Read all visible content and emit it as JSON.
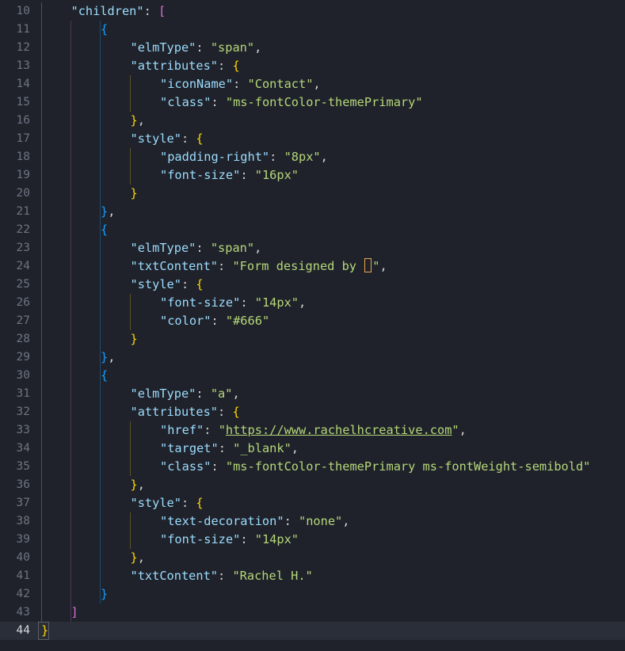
{
  "editor": {
    "active_line": 44,
    "lines": [
      {
        "num": "10",
        "tokens": [
          [
            "k",
            "\"children\""
          ],
          [
            "p",
            ": "
          ],
          [
            "b2",
            "["
          ]
        ]
      },
      {
        "num": "11",
        "tokens": [
          [
            "b3",
            "{"
          ]
        ]
      },
      {
        "num": "12",
        "tokens": [
          [
            "k",
            "\"elmType\""
          ],
          [
            "p",
            ": "
          ],
          [
            "s",
            "\"span\""
          ],
          [
            "p",
            ","
          ]
        ]
      },
      {
        "num": "13",
        "tokens": [
          [
            "k",
            "\"attributes\""
          ],
          [
            "p",
            ": "
          ],
          [
            "b1",
            "{"
          ]
        ]
      },
      {
        "num": "14",
        "tokens": [
          [
            "k",
            "\"iconName\""
          ],
          [
            "p",
            ": "
          ],
          [
            "s",
            "\"Contact\""
          ],
          [
            "p",
            ","
          ]
        ]
      },
      {
        "num": "15",
        "tokens": [
          [
            "k",
            "\"class\""
          ],
          [
            "p",
            ": "
          ],
          [
            "s",
            "\"ms-fontColor-themePrimary\""
          ]
        ]
      },
      {
        "num": "16",
        "tokens": [
          [
            "b1",
            "}"
          ],
          [
            "p",
            ","
          ]
        ]
      },
      {
        "num": "17",
        "tokens": [
          [
            "k",
            "\"style\""
          ],
          [
            "p",
            ": "
          ],
          [
            "b1",
            "{"
          ]
        ]
      },
      {
        "num": "18",
        "tokens": [
          [
            "k",
            "\"padding-right\""
          ],
          [
            "p",
            ": "
          ],
          [
            "s",
            "\"8px\""
          ],
          [
            "p",
            ","
          ]
        ]
      },
      {
        "num": "19",
        "tokens": [
          [
            "k",
            "\"font-size\""
          ],
          [
            "p",
            ": "
          ],
          [
            "s",
            "\"16px\""
          ]
        ]
      },
      {
        "num": "20",
        "tokens": [
          [
            "b1",
            "}"
          ]
        ]
      },
      {
        "num": "21",
        "tokens": [
          [
            "b3",
            "}"
          ],
          [
            "p",
            ","
          ]
        ]
      },
      {
        "num": "22",
        "tokens": [
          [
            "b3",
            "{"
          ]
        ]
      },
      {
        "num": "23",
        "tokens": [
          [
            "k",
            "\"elmType\""
          ],
          [
            "p",
            ": "
          ],
          [
            "s",
            "\"span\""
          ],
          [
            "p",
            ","
          ]
        ]
      },
      {
        "num": "24",
        "tokens": [
          [
            "k",
            "\"txtContent\""
          ],
          [
            "p",
            ": "
          ],
          [
            "s",
            "\"Form designed by "
          ],
          [
            "cursor",
            ""
          ],
          [
            "s",
            "\""
          ],
          [
            "p",
            ","
          ]
        ]
      },
      {
        "num": "25",
        "tokens": [
          [
            "k",
            "\"style\""
          ],
          [
            "p",
            ": "
          ],
          [
            "b1",
            "{"
          ]
        ]
      },
      {
        "num": "26",
        "tokens": [
          [
            "k",
            "\"font-size\""
          ],
          [
            "p",
            ": "
          ],
          [
            "s",
            "\"14px\""
          ],
          [
            "p",
            ","
          ]
        ]
      },
      {
        "num": "27",
        "tokens": [
          [
            "k",
            "\"color\""
          ],
          [
            "p",
            ": "
          ],
          [
            "s",
            "\"#666\""
          ]
        ]
      },
      {
        "num": "28",
        "tokens": [
          [
            "b1",
            "}"
          ]
        ]
      },
      {
        "num": "29",
        "tokens": [
          [
            "b3",
            "}"
          ],
          [
            "p",
            ","
          ]
        ]
      },
      {
        "num": "30",
        "tokens": [
          [
            "b3",
            "{"
          ]
        ]
      },
      {
        "num": "31",
        "tokens": [
          [
            "k",
            "\"elmType\""
          ],
          [
            "p",
            ": "
          ],
          [
            "s",
            "\"a\""
          ],
          [
            "p",
            ","
          ]
        ]
      },
      {
        "num": "32",
        "tokens": [
          [
            "k",
            "\"attributes\""
          ],
          [
            "p",
            ": "
          ],
          [
            "b1",
            "{"
          ]
        ]
      },
      {
        "num": "33",
        "tokens": [
          [
            "k",
            "\"href\""
          ],
          [
            "p",
            ": "
          ],
          [
            "s",
            "\""
          ],
          [
            "link",
            "https://www.rachelhcreative.com"
          ],
          [
            "s",
            "\""
          ],
          [
            "p",
            ","
          ]
        ]
      },
      {
        "num": "34",
        "tokens": [
          [
            "k",
            "\"target\""
          ],
          [
            "p",
            ": "
          ],
          [
            "s",
            "\"_blank\""
          ],
          [
            "p",
            ","
          ]
        ]
      },
      {
        "num": "35",
        "tokens": [
          [
            "k",
            "\"class\""
          ],
          [
            "p",
            ": "
          ],
          [
            "s",
            "\"ms-fontColor-themePrimary ms-fontWeight-semibold\""
          ]
        ]
      },
      {
        "num": "36",
        "tokens": [
          [
            "b1",
            "}"
          ],
          [
            "p",
            ","
          ]
        ]
      },
      {
        "num": "37",
        "tokens": [
          [
            "k",
            "\"style\""
          ],
          [
            "p",
            ": "
          ],
          [
            "b1",
            "{"
          ]
        ]
      },
      {
        "num": "38",
        "tokens": [
          [
            "k",
            "\"text-decoration\""
          ],
          [
            "p",
            ": "
          ],
          [
            "s",
            "\"none\""
          ],
          [
            "p",
            ","
          ]
        ]
      },
      {
        "num": "39",
        "tokens": [
          [
            "k",
            "\"font-size\""
          ],
          [
            "p",
            ": "
          ],
          [
            "s",
            "\"14px\""
          ]
        ]
      },
      {
        "num": "40",
        "tokens": [
          [
            "b1",
            "}"
          ],
          [
            "p",
            ","
          ]
        ]
      },
      {
        "num": "41",
        "tokens": [
          [
            "k",
            "\"txtContent\""
          ],
          [
            "p",
            ": "
          ],
          [
            "s",
            "\"Rachel H.\""
          ]
        ]
      },
      {
        "num": "42",
        "tokens": [
          [
            "b3",
            "}"
          ]
        ]
      },
      {
        "num": "43",
        "tokens": [
          [
            "b2",
            "]"
          ]
        ]
      },
      {
        "num": "44",
        "tokens": [
          [
            "b1",
            "}"
          ]
        ]
      }
    ]
  }
}
